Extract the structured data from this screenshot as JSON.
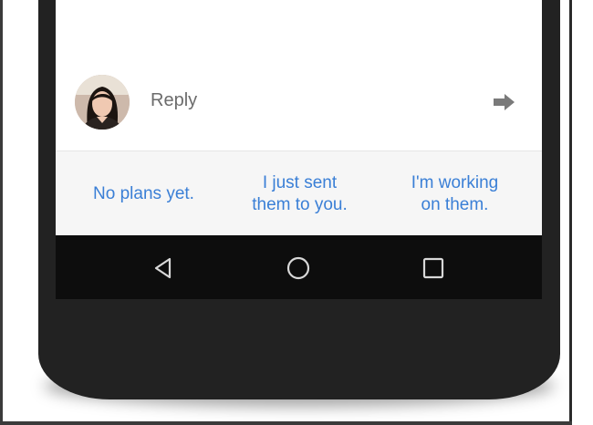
{
  "reply_bar": {
    "placeholder": "Reply",
    "avatar_icon": "user-avatar-photo",
    "send_icon": "arrow-right-icon"
  },
  "smart_replies": [
    {
      "label": "No plans yet."
    },
    {
      "label": "I just sent\nthem to you."
    },
    {
      "label": "I'm working\non them."
    }
  ],
  "nav_bar": {
    "back_icon": "back-triangle-icon",
    "home_icon": "home-circle-icon",
    "recents_icon": "recents-square-icon"
  },
  "colors": {
    "suggestion_text": "#3a7fd6",
    "reply_text": "#6b6b6b",
    "phone_body": "#222222",
    "nav_bar": "#0d0d0d",
    "suggestion_bg": "#f6f6f6"
  }
}
